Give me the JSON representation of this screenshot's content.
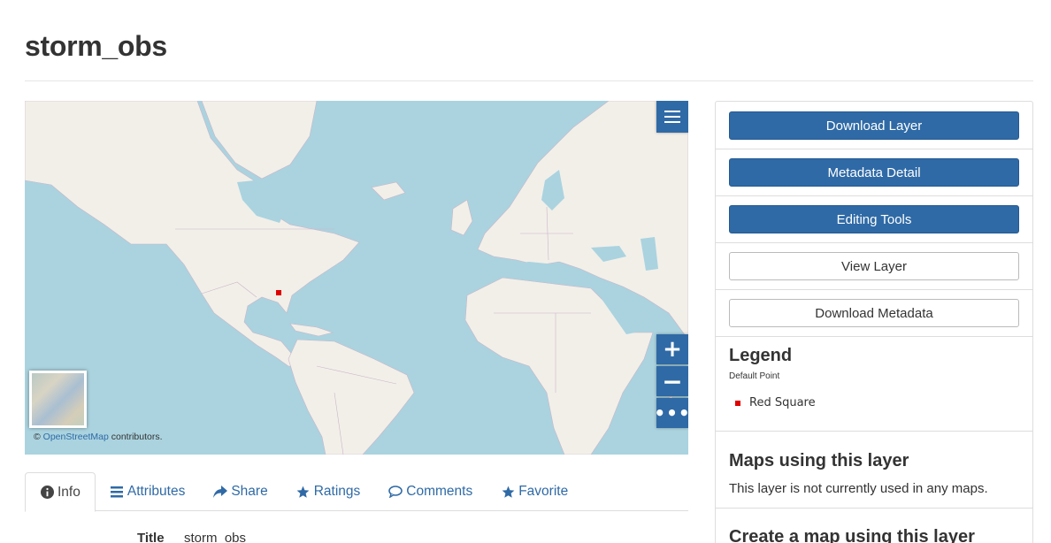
{
  "page": {
    "title": "storm_obs"
  },
  "map": {
    "attribution_prefix": "©",
    "attribution_link": "OpenStreetMap",
    "attribution_suffix": "contributors.",
    "controls": {
      "layer_switcher_icon": "hamburger-icon",
      "zoom_in": "+",
      "zoom_out": "−",
      "more": "•••"
    },
    "colors": {
      "water": "#aad3df",
      "land": "#f2efe9",
      "marker": "#e00000",
      "control": "#2f6aa6"
    }
  },
  "tabs": [
    {
      "label": "Info",
      "icon": "info-icon",
      "active": true
    },
    {
      "label": "Attributes",
      "icon": "list-icon"
    },
    {
      "label": "Share",
      "icon": "share-icon"
    },
    {
      "label": "Ratings",
      "icon": "star-icon"
    },
    {
      "label": "Comments",
      "icon": "comment-icon"
    },
    {
      "label": "Favorite",
      "icon": "star-icon"
    }
  ],
  "info": {
    "title_label": "Title",
    "title_value": "storm_obs"
  },
  "sidebar": {
    "buttons": {
      "download_layer": "Download Layer",
      "metadata_detail": "Metadata Detail",
      "editing_tools": "Editing Tools",
      "view_layer": "View Layer",
      "download_metadata": "Download Metadata"
    },
    "legend": {
      "title": "Legend",
      "style_name": "Default Point",
      "item_label": "Red Square"
    },
    "maps": {
      "title": "Maps using this layer",
      "text": "This layer is not currently used in any maps."
    },
    "create": {
      "title": "Create a map using this layer"
    }
  }
}
